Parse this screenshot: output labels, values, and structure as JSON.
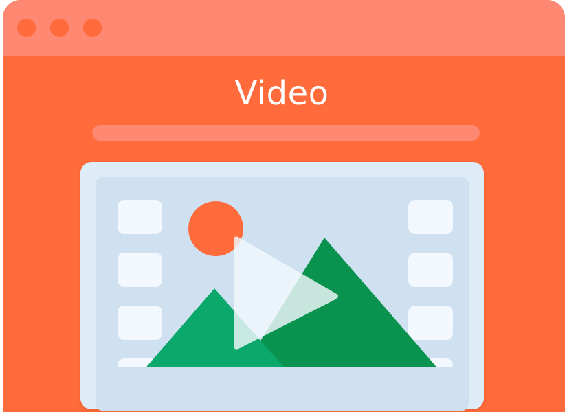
{
  "window": {
    "title_text": "Video",
    "controls": [
      "close-dot",
      "minimize-dot",
      "maximize-dot"
    ]
  },
  "colors": {
    "background": "#ff6b3a",
    "titlebar": "#ff8873",
    "frame_outer": "#deecf7",
    "frame_inner": "#cfe0f1",
    "sprocket": "#f2f8fd",
    "sun": "#ff6b3a",
    "mountain_left": "#0aa86a",
    "mountain_right": "#0a934e",
    "play": "#f2f8fd"
  },
  "icons": {
    "media": "video-thumbnail-icon",
    "play": "play-icon",
    "sun": "sun-icon",
    "mountains": "mountains-icon"
  }
}
